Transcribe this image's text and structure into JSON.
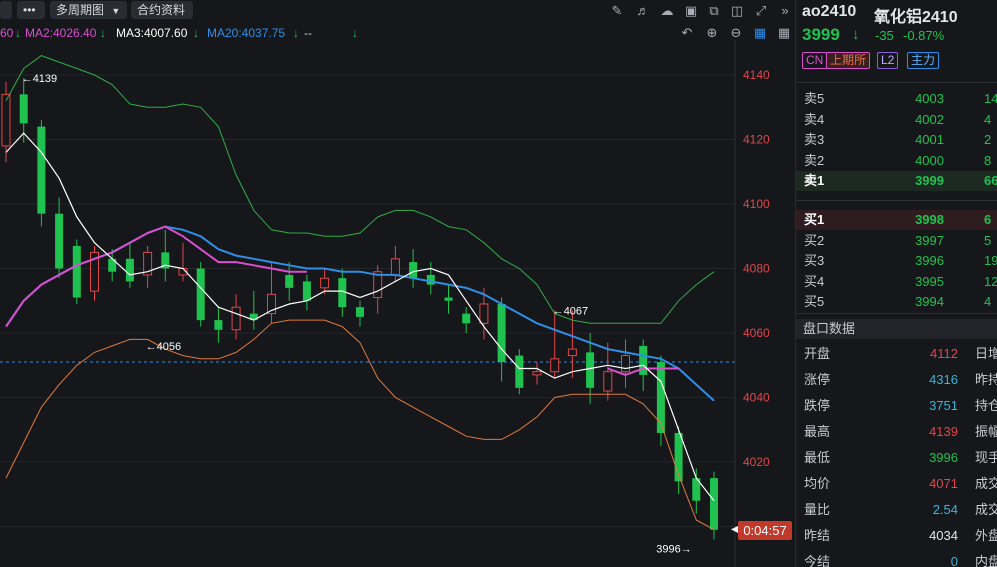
{
  "toolbar": {
    "more_label": "•••",
    "multi_period_label": "多周期图",
    "contract_info_label": "合约资料"
  },
  "ma_legend": {
    "cut_value": "60",
    "ma2": "MA2:4026.40",
    "ma3": "MA3:4007.60",
    "ma20": "MA20:4037.75",
    "extra": "--"
  },
  "colors": {
    "up": "#e0464a",
    "down": "#1fc24e",
    "ma_blue": "#2f8fe6",
    "ma_magenta": "#d94fd0",
    "boll_green": "#2fae45",
    "boll_orange": "#e07a3c",
    "ma_white": "#ffffff"
  },
  "chart_data": {
    "type": "candlestick",
    "y_ticks": [
      4140,
      4120,
      4100,
      4080,
      4060,
      4040,
      4020
    ],
    "ylim": [
      3990,
      4156
    ],
    "reference_line": 4051,
    "annotations": [
      {
        "text": "4139",
        "value": 4139,
        "index": 1
      },
      {
        "text": "4056",
        "value": 4056,
        "index": 8
      },
      {
        "text": "4067",
        "value": 4067,
        "index": 31
      },
      {
        "text": "3996",
        "value": 3996,
        "index": 39
      }
    ],
    "candles": [
      [
        4118,
        4134,
        4113,
        4138
      ],
      [
        4134,
        4125,
        4119,
        4139
      ],
      [
        4124,
        4097,
        4093,
        4126
      ],
      [
        4097,
        4080,
        4077,
        4102
      ],
      [
        4087,
        4071,
        4069,
        4089
      ],
      [
        4073,
        4085,
        4070,
        4087
      ],
      [
        4083,
        4079,
        4076,
        4086
      ],
      [
        4083,
        4076,
        4074,
        4088
      ],
      [
        4078,
        4085,
        4074,
        4087
      ],
      [
        4085,
        4080,
        4076,
        4092
      ],
      [
        4078,
        4080,
        4076,
        4088
      ],
      [
        4080,
        4064,
        4062,
        4082
      ],
      [
        4064,
        4061,
        4057,
        4068
      ],
      [
        4061,
        4068,
        4058,
        4072
      ],
      [
        4066,
        4064,
        4061,
        4073
      ],
      [
        4066,
        4072,
        4063,
        4082
      ],
      [
        4078,
        4074,
        4070,
        4082
      ],
      [
        4076,
        4070,
        4067,
        4078
      ],
      [
        4074,
        4077,
        4072,
        4080
      ],
      [
        4077,
        4068,
        4065,
        4080
      ],
      [
        4068,
        4065,
        4062,
        4070
      ],
      [
        4071,
        4079,
        4066,
        4081
      ],
      [
        4078,
        4083,
        4076,
        4087
      ],
      [
        4082,
        4077,
        4074,
        4086
      ],
      [
        4078,
        4075,
        4072,
        4082
      ],
      [
        4071,
        4070,
        4066,
        4075
      ],
      [
        4066,
        4063,
        4060,
        4068
      ],
      [
        4063,
        4069,
        4058,
        4074
      ],
      [
        4069,
        4051,
        4045,
        4071
      ],
      [
        4053,
        4043,
        4041,
        4055
      ],
      [
        4047,
        4048,
        4044,
        4051
      ],
      [
        4048,
        4052,
        4046,
        4067
      ],
      [
        4053,
        4055,
        4046,
        4067
      ],
      [
        4054,
        4043,
        4038,
        4060
      ],
      [
        4042,
        4048,
        4039,
        4057
      ],
      [
        4048,
        4053,
        4043,
        4058
      ],
      [
        4056,
        4047,
        4042,
        4058
      ],
      [
        4051,
        4029,
        4025,
        4053
      ],
      [
        4029,
        4014,
        4010,
        4031
      ],
      [
        4015,
        4008,
        4004,
        4018
      ],
      [
        4015,
        3999,
        3996,
        4017
      ]
    ],
    "ma_white": [
      4116,
      4122,
      4116,
      4108,
      4096,
      4088,
      4083,
      4078,
      4079,
      4081,
      4080,
      4074,
      4068,
      4066,
      4064,
      4067,
      4069,
      4070,
      4073,
      4073,
      4071,
      4073,
      4076,
      4079,
      4080,
      4078,
      4070,
      4062,
      4055,
      4049,
      4049,
      4046,
      4048,
      4049,
      4050,
      4049,
      4050,
      4045,
      4030,
      4015,
      4008
    ],
    "ma_blue": [
      4062,
      4070,
      4075,
      4078,
      4081,
      4083,
      4085,
      4088,
      4091,
      4093,
      4092,
      4090,
      4086,
      4084,
      4083,
      4082,
      4081,
      4080,
      4080,
      4079,
      4079,
      4078,
      4078,
      4077,
      4076,
      4075,
      4074,
      4072,
      4069,
      4066,
      4063,
      4061,
      4059,
      4057,
      4055,
      4054,
      4053,
      4052,
      4049,
      4044,
      4039
    ],
    "ma_magenta": [
      4062,
      4070,
      4075,
      4078,
      4081,
      4083,
      4085,
      4088,
      4091,
      4093,
      4090,
      4086,
      4082,
      4082,
      4081,
      4080,
      4079,
      4079
    ],
    "ma_magenta_tail": [
      4049,
      4047,
      4049,
      4049,
      4049
    ],
    "ma_magenta_tail_start": 34,
    "boll_upper": [
      4132,
      4142,
      4146,
      4144,
      4142,
      4140,
      4137,
      4131,
      4130,
      4130,
      4131,
      4130,
      4124,
      4109,
      4098,
      4092,
      4091,
      4091,
      4090,
      4090,
      4091,
      4096,
      4098,
      4098,
      4096,
      4093,
      4092,
      4088,
      4083,
      4080,
      4075,
      4066,
      4064,
      4063,
      4063,
      4063,
      4063,
      4063,
      4070,
      4075,
      4079
    ],
    "boll_lower": [
      4015,
      4026,
      4037,
      4044,
      4050,
      4054,
      4056,
      4058,
      4058,
      4055,
      4053,
      4052,
      4052,
      4054,
      4058,
      4063,
      4064,
      4064,
      4064,
      4062,
      4057,
      4046,
      4040,
      4037,
      4034,
      4031,
      4028,
      4027,
      4027,
      4030,
      4034,
      4040,
      4041,
      4041,
      4041,
      4041,
      4038,
      4032,
      4016,
      4002,
      3999
    ]
  },
  "timer": "0:04:57",
  "panel": {
    "code": "ao2410",
    "name": "氧化铝2410",
    "price": "3999",
    "arrow": "↓",
    "change": "-35",
    "change_pct": "-0.87%",
    "tags": [
      "CN",
      "上期所",
      "L2",
      "主力"
    ],
    "asks": [
      {
        "label": "卖5",
        "price": "4003",
        "vol": "14"
      },
      {
        "label": "卖4",
        "price": "4002",
        "vol": "4"
      },
      {
        "label": "卖3",
        "price": "4001",
        "vol": "2"
      },
      {
        "label": "卖2",
        "price": "4000",
        "vol": "8"
      },
      {
        "label": "卖1",
        "price": "3999",
        "vol": "66"
      }
    ],
    "bids": [
      {
        "label": "买1",
        "price": "3998",
        "vol": "6"
      },
      {
        "label": "买2",
        "price": "3997",
        "vol": "5"
      },
      {
        "label": "买3",
        "price": "3996",
        "vol": "19"
      },
      {
        "label": "买4",
        "price": "3995",
        "vol": "12"
      },
      {
        "label": "买5",
        "price": "3994",
        "vol": "4"
      }
    ],
    "section_title": "盘口数据",
    "quotes": [
      {
        "key": "开盘",
        "value": "4112",
        "color": "up",
        "key2": "日增"
      },
      {
        "key": "涨停",
        "value": "4316",
        "color": "blue",
        "key2": "昨持"
      },
      {
        "key": "跌停",
        "value": "3751",
        "color": "blue",
        "key2": "持仓"
      },
      {
        "key": "最高",
        "value": "4139",
        "color": "up",
        "key2": "振幅"
      },
      {
        "key": "最低",
        "value": "3996",
        "color": "down",
        "key2": "现手"
      },
      {
        "key": "均价",
        "value": "4071",
        "color": "up",
        "key2": "成交"
      },
      {
        "key": "量比",
        "value": "2.54",
        "color": "blue",
        "key2": "成交"
      },
      {
        "key": "昨结",
        "value": "4034",
        "color": "white",
        "key2": "外盘"
      },
      {
        "key": "今结",
        "value": "0",
        "color": "blue",
        "key2": "内盘"
      }
    ]
  }
}
